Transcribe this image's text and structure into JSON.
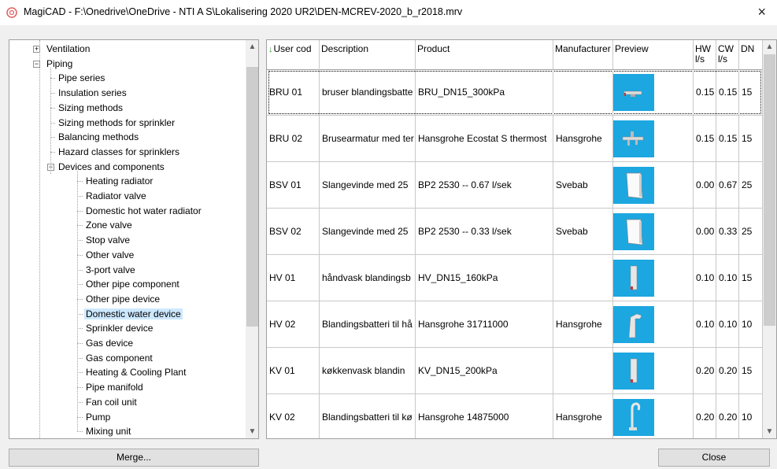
{
  "window": {
    "title": "MagiCAD - F:\\Onedrive\\OneDrive - NTI A S\\Lokalisering 2020 UR2\\DEN-MCREV-2020_b_r2018.mrv",
    "close_glyph": "×"
  },
  "tree": {
    "items": [
      {
        "label": "Ventilation",
        "expander": "+"
      },
      {
        "label": "Piping",
        "expander": "−"
      },
      {
        "label": "Pipe series"
      },
      {
        "label": "Insulation series"
      },
      {
        "label": "Sizing methods"
      },
      {
        "label": "Sizing methods for sprinkler"
      },
      {
        "label": "Balancing methods"
      },
      {
        "label": "Hazard classes for sprinklers"
      },
      {
        "label": "Devices and components",
        "expander": "−"
      },
      {
        "label": "Heating radiator"
      },
      {
        "label": "Radiator valve"
      },
      {
        "label": "Domestic hot water radiator"
      },
      {
        "label": "Zone valve"
      },
      {
        "label": "Stop valve"
      },
      {
        "label": "Other valve"
      },
      {
        "label": "3-port valve"
      },
      {
        "label": "Other pipe component"
      },
      {
        "label": "Other pipe device"
      },
      {
        "label": "Domestic water device",
        "selected": true
      },
      {
        "label": "Sprinkler device"
      },
      {
        "label": "Gas device"
      },
      {
        "label": "Gas component"
      },
      {
        "label": "Heating & Cooling Plant"
      },
      {
        "label": "Pipe manifold"
      },
      {
        "label": "Fan coil unit"
      },
      {
        "label": "Pump"
      },
      {
        "label": "Mixing unit"
      }
    ]
  },
  "grid": {
    "sort_arrow": "↓",
    "columns": [
      "User cod",
      "Description",
      "Product",
      "Manufacturer",
      "Preview",
      "HW l/s",
      "CW l/s",
      "DN"
    ],
    "rows": [
      {
        "user_code": "BRU 01",
        "description": "bruser blandingsbatte",
        "product": "BRU_DN15_300kPa",
        "manufacturer": "",
        "preview_icon": "shower-mixer-icon",
        "hw": "0.15",
        "cw": "0.15",
        "dn": "15"
      },
      {
        "user_code": "BRU 02",
        "description": "Brusearmatur med ter",
        "product": "Hansgrohe Ecostat S thermost",
        "manufacturer": "Hansgrohe",
        "preview_icon": "thermostat-mixer-icon",
        "hw": "0.15",
        "cw": "0.15",
        "dn": "15"
      },
      {
        "user_code": "BSV 01",
        "description": "Slangevinde med 25",
        "product": "BP2 2530 -- 0.67 l/sek",
        "manufacturer": "Svebab",
        "preview_icon": "hose-reel-icon",
        "hw": "0.00",
        "cw": "0.67",
        "dn": "25"
      },
      {
        "user_code": "BSV 02",
        "description": "Slangevinde med 25",
        "product": "BP2 2530 -- 0.33 l/sek",
        "manufacturer": "Svebab",
        "preview_icon": "hose-reel-icon",
        "hw": "0.00",
        "cw": "0.33",
        "dn": "25"
      },
      {
        "user_code": "HV 01",
        "description": "håndvask blandingsb",
        "product": "HV_DN15_160kPa",
        "manufacturer": "",
        "preview_icon": "basin-mixer-icon",
        "hw": "0.10",
        "cw": "0.10",
        "dn": "15"
      },
      {
        "user_code": "HV 02",
        "description": "Blandingsbatteri til hå",
        "product": "Hansgrohe 31711000",
        "manufacturer": "Hansgrohe",
        "preview_icon": "faucet-icon",
        "hw": "0.10",
        "cw": "0.10",
        "dn": "10"
      },
      {
        "user_code": "KV 01",
        "description": "køkkenvask blandin",
        "product": "KV_DN15_200kPa",
        "manufacturer": "",
        "preview_icon": "basin-mixer-icon",
        "hw": "0.20",
        "cw": "0.20",
        "dn": "15"
      },
      {
        "user_code": "KV 02",
        "description": "Blandingsbatteri til kø",
        "product": "Hansgrohe 14875000",
        "manufacturer": "Hansgrohe",
        "preview_icon": "kitchen-faucet-icon",
        "hw": "0.20",
        "cw": "0.20",
        "dn": "10"
      }
    ]
  },
  "buttons": {
    "merge": "Merge...",
    "close": "Close"
  },
  "colors": {
    "preview_bg": "#1ca7e0",
    "selection": "#cce8ff"
  }
}
